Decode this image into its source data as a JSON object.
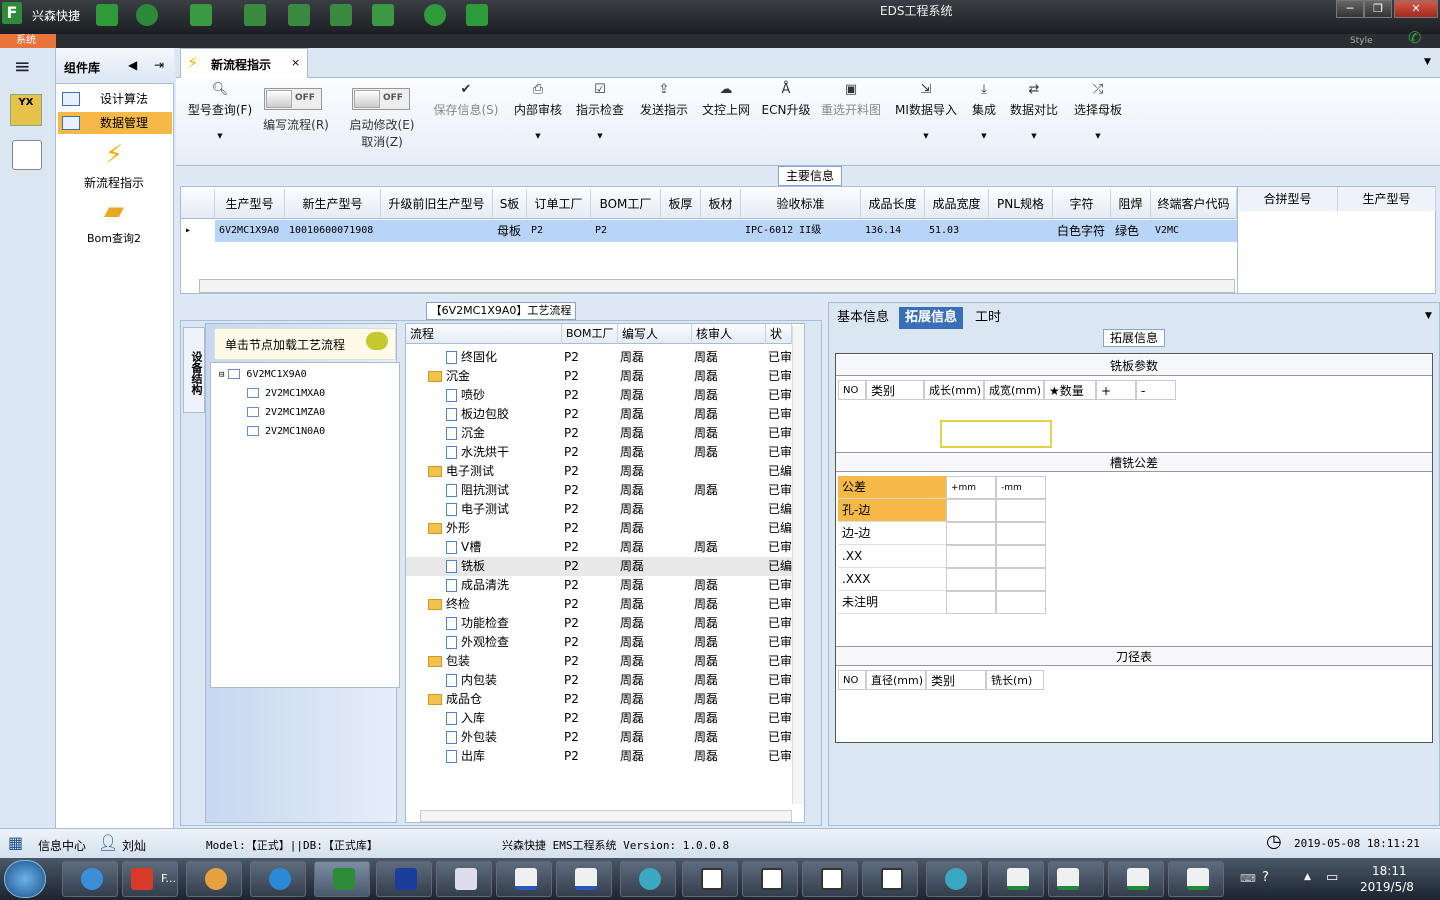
{
  "window": {
    "app_name": "兴森快捷",
    "title": "EDS工程系统",
    "style_label": "Style"
  },
  "sys_tab": "系统",
  "component_panel": {
    "title": "组件库",
    "items": [
      {
        "label": "设计算法"
      },
      {
        "label": "数据管理"
      }
    ],
    "big_items": [
      {
        "label": "新流程指示"
      },
      {
        "label": "Bom查询2"
      }
    ]
  },
  "doc_tab": {
    "label": "新流程指示",
    "close": "×"
  },
  "ribbon": {
    "buttons": [
      {
        "label": "型号查询(F)",
        "icon": "search-icon"
      },
      {
        "label": "保存信息(S)",
        "icon": "check-icon"
      },
      {
        "label": "内部审核",
        "icon": "print-icon"
      },
      {
        "label": "指示检查",
        "icon": "checkbox-icon"
      },
      {
        "label": "发送指示",
        "icon": "upload-icon"
      },
      {
        "label": "文控上网",
        "icon": "cloud-icon"
      },
      {
        "label": "ECN升级",
        "icon": "ecn-icon"
      },
      {
        "label": "重选开料图",
        "icon": "image-icon"
      },
      {
        "label": "MI数据导入",
        "icon": "import-icon"
      },
      {
        "label": "集成",
        "icon": "download-icon"
      },
      {
        "label": "数据对比",
        "icon": "compare-icon"
      },
      {
        "label": "选择母板",
        "icon": "shuffle-icon"
      }
    ],
    "toggles": [
      {
        "state": "OFF",
        "label": "编写流程(R)"
      },
      {
        "state": "OFF",
        "label": "启动修改(E)",
        "label2": "取消(Z)"
      }
    ]
  },
  "main_info": {
    "title": "主要信息",
    "columns": [
      "生产型号",
      "新生产型号",
      "升级前旧生产型号",
      "S板",
      "订单工厂",
      "BOM工厂",
      "板厚",
      "板材",
      "验收标准",
      "成品长度",
      "成品宽度",
      "PNL规格",
      "字符",
      "阻焊",
      "终端客户代码"
    ],
    "row": [
      "6V2MC1X9A0",
      "10010600071908",
      "",
      "母板",
      "P2",
      "P2",
      "",
      "",
      "IPC-6012 II级",
      "136.14",
      "51.03",
      "",
      "白色字符",
      "绿色",
      "V2MC"
    ],
    "merge_columns": [
      "合拼型号",
      "生产型号"
    ]
  },
  "process": {
    "title": "【6V2MC1X9A0】工艺流程",
    "side_tab": "设备结构",
    "hint": "单击节点加载工艺流程",
    "tree": [
      "6V2MC1X9A0",
      "2V2MC1MXA0",
      "2V2MC1MZA0",
      "2V2MC1N0A0"
    ],
    "columns": [
      "流程",
      "BOM工厂",
      "编写人",
      "核审人",
      "状态"
    ],
    "rows": [
      {
        "name": "终固化",
        "level": 2,
        "factory": "P2",
        "writer": "周磊",
        "reviewer": "周磊",
        "status": "已审核"
      },
      {
        "name": "沉金",
        "level": 1,
        "factory": "P2",
        "writer": "周磊",
        "reviewer": "周磊",
        "status": "已审核"
      },
      {
        "name": "喷砂",
        "level": 2,
        "factory": "P2",
        "writer": "周磊",
        "reviewer": "周磊",
        "status": "已审核"
      },
      {
        "name": "板边包胶",
        "level": 2,
        "factory": "P2",
        "writer": "周磊",
        "reviewer": "周磊",
        "status": "已审核"
      },
      {
        "name": "沉金",
        "level": 2,
        "factory": "P2",
        "writer": "周磊",
        "reviewer": "周磊",
        "status": "已审核"
      },
      {
        "name": "水洗烘干",
        "level": 2,
        "factory": "P2",
        "writer": "周磊",
        "reviewer": "周磊",
        "status": "已审核"
      },
      {
        "name": "电子测试",
        "level": 1,
        "factory": "P2",
        "writer": "周磊",
        "reviewer": "",
        "status": "已编写"
      },
      {
        "name": "阻抗测试",
        "level": 2,
        "factory": "P2",
        "writer": "周磊",
        "reviewer": "周磊",
        "status": "已审核"
      },
      {
        "name": "电子测试",
        "level": 2,
        "factory": "P2",
        "writer": "周磊",
        "reviewer": "",
        "status": "已编写"
      },
      {
        "name": "外形",
        "level": 1,
        "factory": "P2",
        "writer": "周磊",
        "reviewer": "",
        "status": "已编写"
      },
      {
        "name": "V槽",
        "level": 2,
        "factory": "P2",
        "writer": "周磊",
        "reviewer": "周磊",
        "status": "已审核"
      },
      {
        "name": "铣板",
        "level": 2,
        "factory": "P2",
        "writer": "周磊",
        "reviewer": "",
        "status": "已编写"
      },
      {
        "name": "成品清洗",
        "level": 2,
        "factory": "P2",
        "writer": "周磊",
        "reviewer": "周磊",
        "status": "已审核"
      },
      {
        "name": "终检",
        "level": 1,
        "factory": "P2",
        "writer": "周磊",
        "reviewer": "周磊",
        "status": "已审核"
      },
      {
        "name": "功能检查",
        "level": 2,
        "factory": "P2",
        "writer": "周磊",
        "reviewer": "周磊",
        "status": "已审核"
      },
      {
        "name": "外观检查",
        "level": 2,
        "factory": "P2",
        "writer": "周磊",
        "reviewer": "周磊",
        "status": "已审核"
      },
      {
        "name": "包装",
        "level": 1,
        "factory": "P2",
        "writer": "周磊",
        "reviewer": "周磊",
        "status": "已审核"
      },
      {
        "name": "内包装",
        "level": 2,
        "factory": "P2",
        "writer": "周磊",
        "reviewer": "周磊",
        "status": "已审核"
      },
      {
        "name": "成品仓",
        "level": 1,
        "factory": "P2",
        "writer": "周磊",
        "reviewer": "周磊",
        "status": "已审核"
      },
      {
        "name": "入库",
        "level": 2,
        "factory": "P2",
        "writer": "周磊",
        "reviewer": "周磊",
        "status": "已审核"
      },
      {
        "name": "外包装",
        "level": 2,
        "factory": "P2",
        "writer": "周磊",
        "reviewer": "周磊",
        "status": "已审核"
      },
      {
        "name": "出库",
        "level": 2,
        "factory": "P2",
        "writer": "周磊",
        "reviewer": "周磊",
        "status": "已审核"
      }
    ]
  },
  "right": {
    "tabs": [
      "基本信息",
      "拓展信息",
      "工时"
    ],
    "ext_title": "拓展信息",
    "steel": {
      "title": "铣板参数",
      "cols": [
        "NO",
        "类别",
        "成长(mm)",
        "成宽(mm)",
        "★数量",
        "+",
        "-"
      ]
    },
    "tolerance": {
      "title": "槽铣公差",
      "head": [
        "公差",
        "+mm",
        "-mm"
      ],
      "rows": [
        "孔-边",
        "边-边",
        ".XX",
        ".XXX",
        "未注明"
      ]
    },
    "tool": {
      "title": "刀径表",
      "cols": [
        "NO",
        "直径(mm)",
        "类别",
        "铣长(m)"
      ]
    }
  },
  "status": {
    "info_center": "信息中心",
    "user": "刘灿",
    "mode": "Model:【正式】||DB:【正式库】",
    "version": "兴森快捷 EMS工程系统 Version: 1.0.0.8",
    "datetime": "2019-05-08 18:11:21"
  },
  "taskbar": {
    "time": "18:11",
    "date": "2019/5/8",
    "item_label": "F..."
  }
}
